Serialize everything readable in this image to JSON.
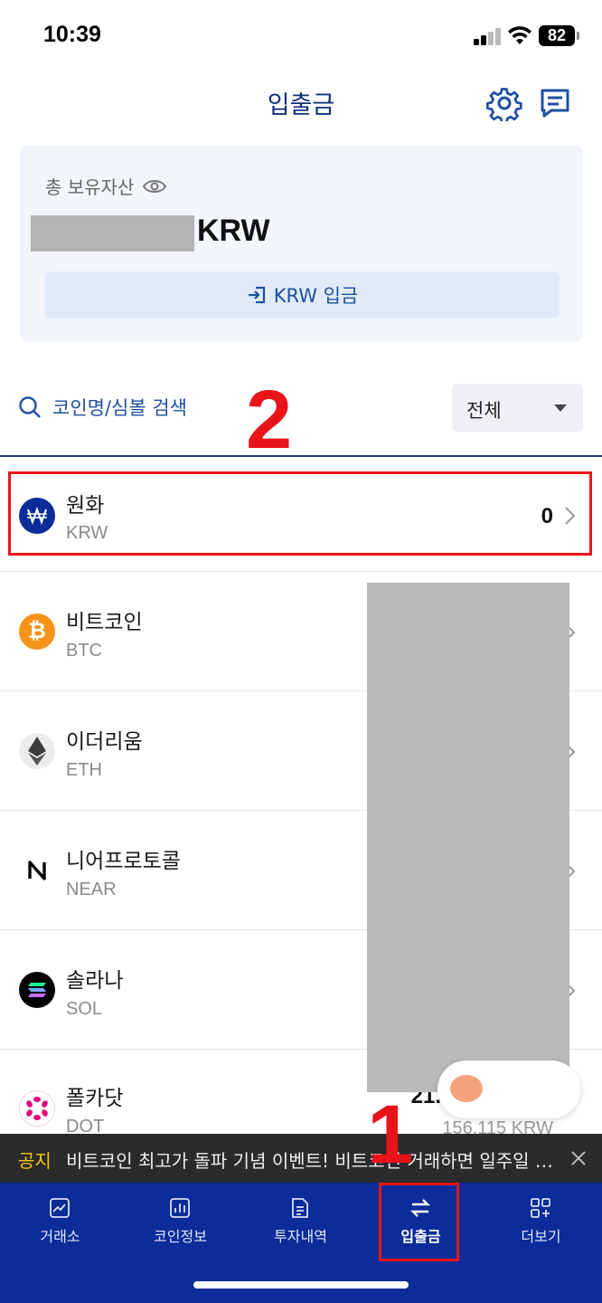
{
  "status": {
    "time": "10:39",
    "battery": "82"
  },
  "header": {
    "title": "입출금",
    "icons": [
      "gear-icon",
      "chat-icon"
    ]
  },
  "asset": {
    "label": "총 보유자산",
    "unit": "KRW",
    "deposit_button": "KRW 입금"
  },
  "search": {
    "placeholder": "코인명/심볼 검색",
    "filter": "전체"
  },
  "annotations": {
    "step1": "1",
    "step2": "2",
    "highlight_color": "#e8141a"
  },
  "coins": [
    {
      "name": "원화",
      "symbol": "KRW",
      "amount": "0",
      "icon": "won-icon",
      "color": "#0b2c99"
    },
    {
      "name": "비트코인",
      "symbol": "BTC",
      "icon": "bitcoin-icon",
      "color": "#f7931a"
    },
    {
      "name": "이더리움",
      "symbol": "ETH",
      "icon": "ethereum-icon",
      "color": "#3c3c3d"
    },
    {
      "name": "니어프로토콜",
      "symbol": "NEAR",
      "icon": "near-icon",
      "color": "#000000"
    },
    {
      "name": "솔라나",
      "symbol": "SOL",
      "icon": "solana-icon",
      "color": "#000000"
    },
    {
      "name": "폴카닷",
      "symbol": "DOT",
      "amount_partial": "21.",
      "value": "156,115 KRW",
      "icon": "polkadot-icon",
      "color": "#e6007a"
    }
  ],
  "notice": {
    "tag": "공지",
    "text": "비트코인 최고가 돌파 기념 이벤트! 비트코인 거래하면 일주일 간 수수료 무료"
  },
  "nav": [
    {
      "label": "거래소",
      "icon": "exchange-chart-icon"
    },
    {
      "label": "코인정보",
      "icon": "coin-info-icon"
    },
    {
      "label": "투자내역",
      "icon": "history-doc-icon"
    },
    {
      "label": "입출금",
      "icon": "transfer-arrows-icon",
      "active": true
    },
    {
      "label": "더보기",
      "icon": "more-grid-icon"
    }
  ]
}
